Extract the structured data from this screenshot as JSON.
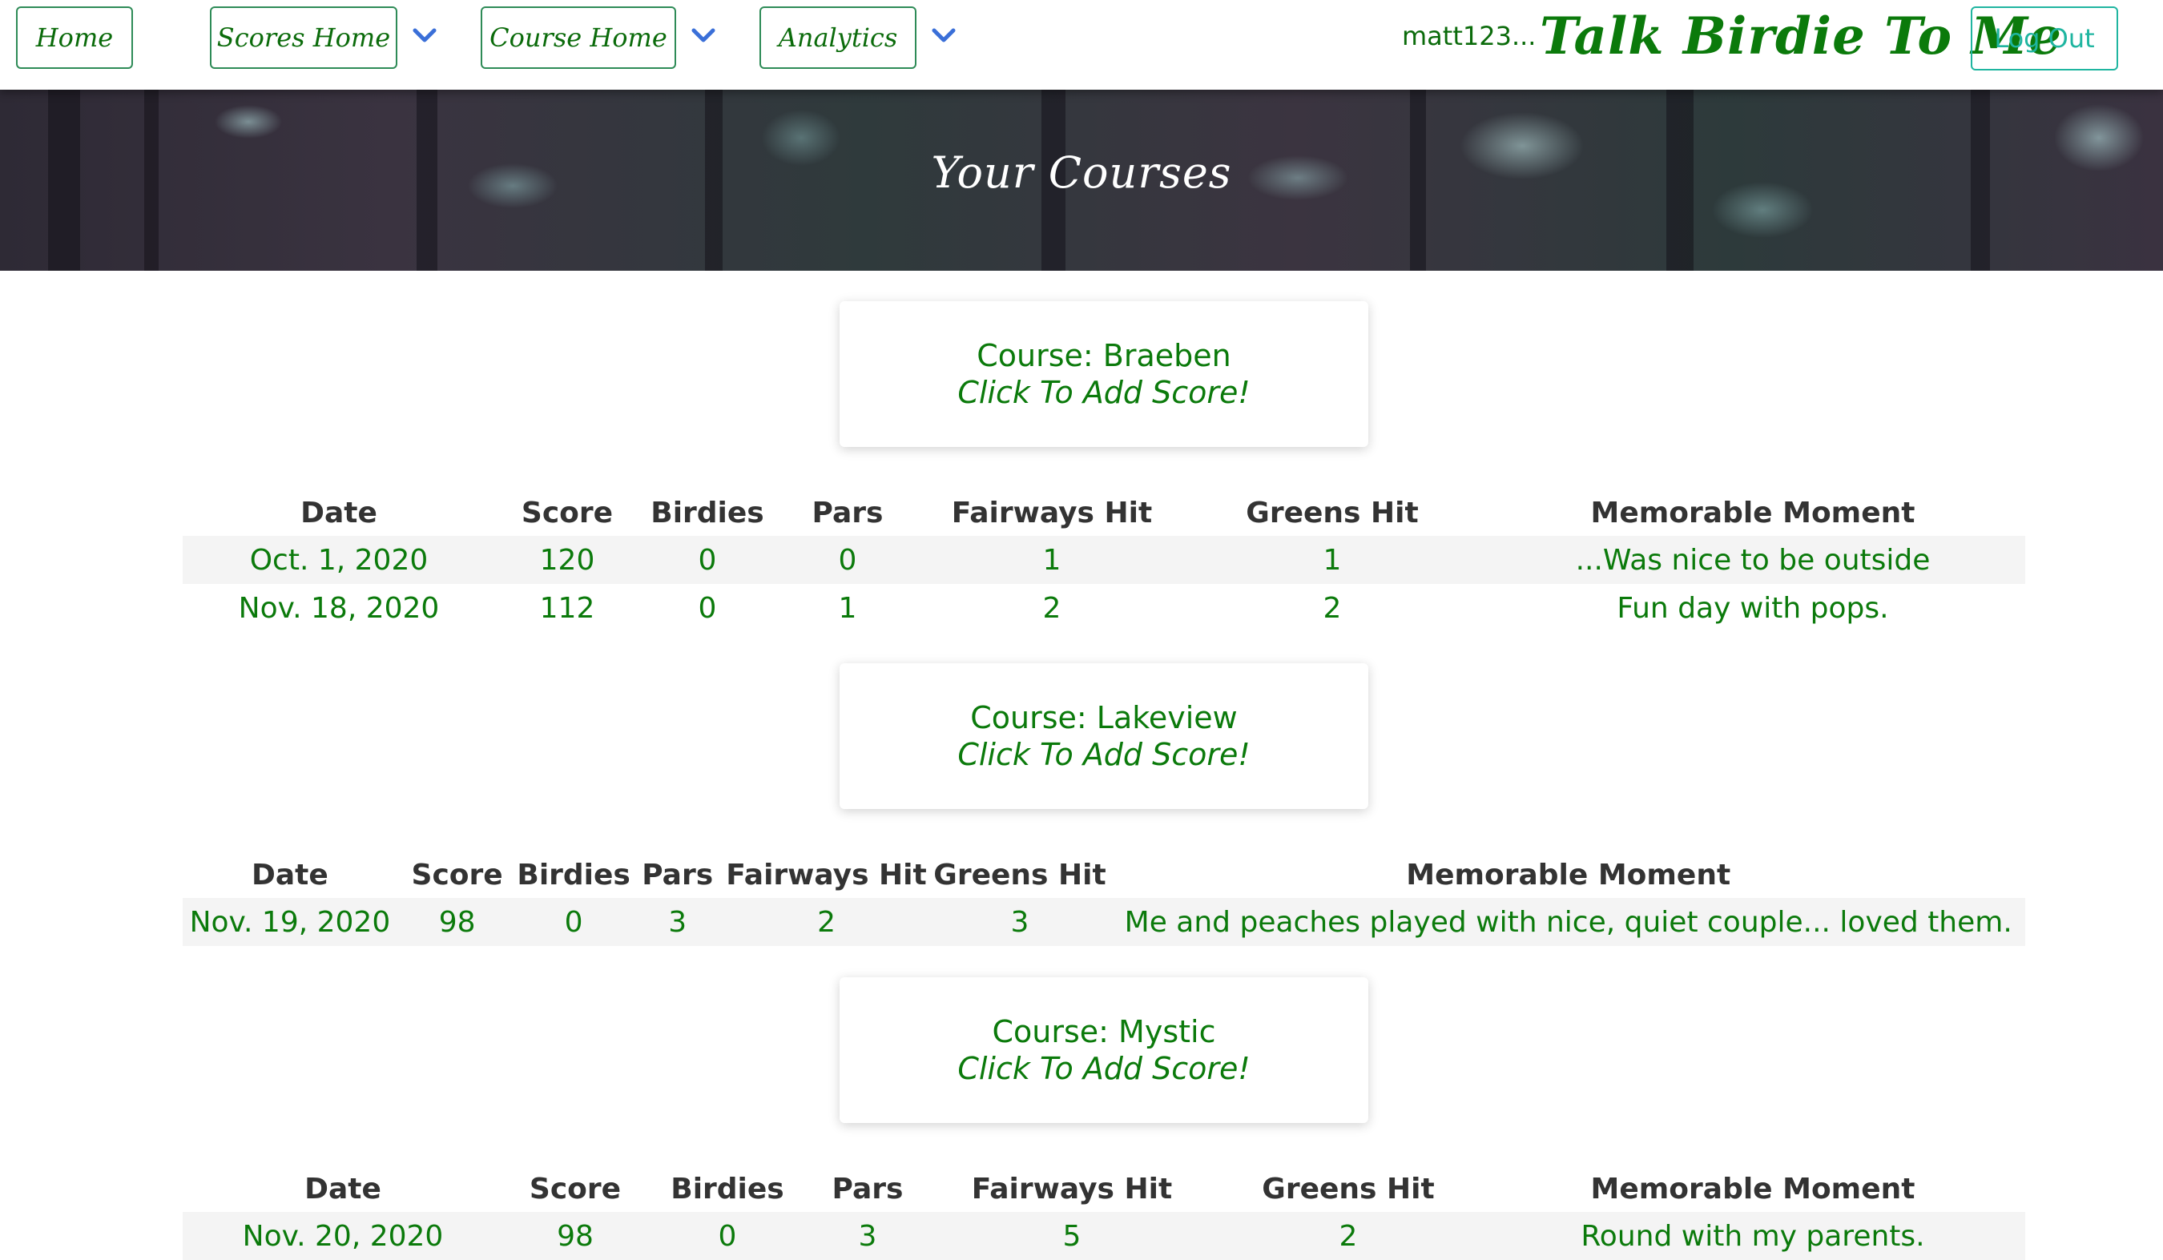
{
  "nav": {
    "home": "Home",
    "scores_home": "Scores Home",
    "course_home": "Course Home",
    "analytics": "Analytics",
    "username": "matt123...",
    "brand": "Talk Birdie To Me",
    "logout": "Log Out"
  },
  "hero": {
    "title": "Your Courses"
  },
  "columns": [
    "Date",
    "Score",
    "Birdies",
    "Pars",
    "Fairways Hit",
    "Greens Hit",
    "Memorable Moment"
  ],
  "add_score_label": "Click To Add Score!",
  "courses": [
    {
      "name": "Course: Braeben",
      "rounds": [
        {
          "date": "Oct. 1, 2020",
          "score": "120",
          "birdies": "0",
          "pars": "0",
          "fairways": "1",
          "greens": "1",
          "moment": "...Was nice to be outside"
        },
        {
          "date": "Nov. 18, 2020",
          "score": "112",
          "birdies": "0",
          "pars": "1",
          "fairways": "2",
          "greens": "2",
          "moment": "Fun day with pops."
        }
      ]
    },
    {
      "name": "Course: Lakeview",
      "rounds": [
        {
          "date": "Nov. 19, 2020",
          "score": "98",
          "birdies": "0",
          "pars": "3",
          "fairways": "2",
          "greens": "3",
          "moment": "Me and peaches played with nice, quiet couple... loved them."
        }
      ]
    },
    {
      "name": "Course: Mystic",
      "rounds": [
        {
          "date": "Nov. 20, 2020",
          "score": "98",
          "birdies": "0",
          "pars": "3",
          "fairways": "5",
          "greens": "2",
          "moment": "Round with my parents."
        }
      ]
    }
  ],
  "colors": {
    "brand_green": "#0b7a0b",
    "logout_teal": "#1fb5a0",
    "chevron_blue": "#3a6fd8"
  }
}
